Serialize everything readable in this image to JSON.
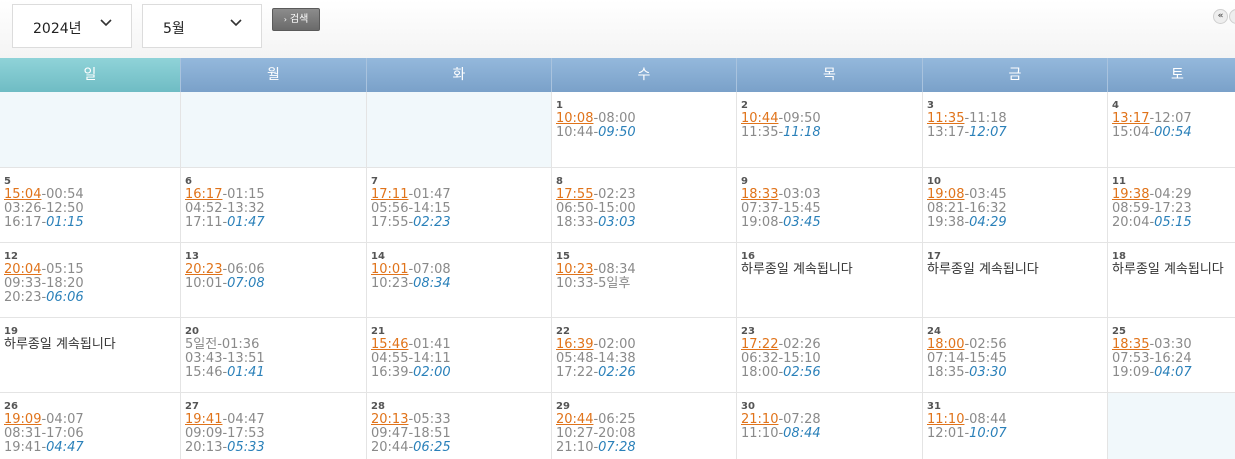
{
  "toolbar": {
    "year": "2024년",
    "month": "5월",
    "search_label": "검색",
    "prev_label": "«"
  },
  "weekdays": [
    "일",
    "월",
    "화",
    "수",
    "목",
    "금",
    "토"
  ],
  "colors": {
    "highlight": "#e0731a",
    "italic": "#2a80b9",
    "sunday_header": "#7fc7ce",
    "header": "#86abd2"
  },
  "weeks": [
    [
      {
        "empty": true
      },
      {
        "empty": true
      },
      {
        "empty": true
      },
      {
        "day": "1",
        "lines": [
          {
            "a": "10:08",
            "b": "-08:00",
            "t": "hl"
          },
          {
            "a": "10:44-",
            "b": "09:50",
            "t": "it"
          }
        ]
      },
      {
        "day": "2",
        "lines": [
          {
            "a": "10:44",
            "b": "-09:50",
            "t": "hl"
          },
          {
            "a": "11:35-",
            "b": "11:18",
            "t": "it"
          }
        ]
      },
      {
        "day": "3",
        "lines": [
          {
            "a": "11:35",
            "b": "-11:18",
            "t": "hl"
          },
          {
            "a": "13:17-",
            "b": "12:07",
            "t": "it"
          }
        ]
      },
      {
        "day": "4",
        "lines": [
          {
            "a": "13:17",
            "b": "-12:07",
            "t": "hl"
          },
          {
            "a": "15:04-",
            "b": "00:54",
            "t": "it"
          }
        ]
      }
    ],
    [
      {
        "day": "5",
        "lines": [
          {
            "a": "15:04",
            "b": "-00:54",
            "t": "hl"
          },
          {
            "a": "03:26-12:50",
            "b": "",
            "t": "nm"
          },
          {
            "a": "16:17-",
            "b": "01:15",
            "t": "it"
          }
        ]
      },
      {
        "day": "6",
        "lines": [
          {
            "a": "16:17",
            "b": "-01:15",
            "t": "hl"
          },
          {
            "a": "04:52-13:32",
            "b": "",
            "t": "nm"
          },
          {
            "a": "17:11-",
            "b": "01:47",
            "t": "it"
          }
        ]
      },
      {
        "day": "7",
        "lines": [
          {
            "a": "17:11",
            "b": "-01:47",
            "t": "hl"
          },
          {
            "a": "05:56-14:15",
            "b": "",
            "t": "nm"
          },
          {
            "a": "17:55-",
            "b": "02:23",
            "t": "it"
          }
        ]
      },
      {
        "day": "8",
        "lines": [
          {
            "a": "17:55",
            "b": "-02:23",
            "t": "hl"
          },
          {
            "a": "06:50-15:00",
            "b": "",
            "t": "nm"
          },
          {
            "a": "18:33-",
            "b": "03:03",
            "t": "it"
          }
        ]
      },
      {
        "day": "9",
        "lines": [
          {
            "a": "18:33",
            "b": "-03:03",
            "t": "hl"
          },
          {
            "a": "07:37-15:45",
            "b": "",
            "t": "nm"
          },
          {
            "a": "19:08-",
            "b": "03:45",
            "t": "it"
          }
        ]
      },
      {
        "day": "10",
        "lines": [
          {
            "a": "19:08",
            "b": "-03:45",
            "t": "hl"
          },
          {
            "a": "08:21-16:32",
            "b": "",
            "t": "nm"
          },
          {
            "a": "19:38-",
            "b": "04:29",
            "t": "it"
          }
        ]
      },
      {
        "day": "11",
        "lines": [
          {
            "a": "19:38",
            "b": "-04:29",
            "t": "hl"
          },
          {
            "a": "08:59-17:23",
            "b": "",
            "t": "nm"
          },
          {
            "a": "20:04-",
            "b": "05:15",
            "t": "it"
          }
        ]
      }
    ],
    [
      {
        "day": "12",
        "lines": [
          {
            "a": "20:04",
            "b": "-05:15",
            "t": "hl"
          },
          {
            "a": "09:33-18:20",
            "b": "",
            "t": "nm"
          },
          {
            "a": "20:23-",
            "b": "06:06",
            "t": "it"
          }
        ]
      },
      {
        "day": "13",
        "lines": [
          {
            "a": "20:23",
            "b": "-06:06",
            "t": "hl"
          },
          {
            "a": "10:01-",
            "b": "07:08",
            "t": "it"
          }
        ]
      },
      {
        "day": "14",
        "lines": [
          {
            "a": "10:01",
            "b": "-07:08",
            "t": "hl"
          },
          {
            "a": "10:23-",
            "b": "08:34",
            "t": "it"
          }
        ]
      },
      {
        "day": "15",
        "lines": [
          {
            "a": "10:23",
            "b": "-08:34",
            "t": "hl"
          },
          {
            "a": "10:33-5일후",
            "b": "",
            "t": "nm"
          }
        ]
      },
      {
        "day": "16",
        "allday": "하루종일 계속됩니다"
      },
      {
        "day": "17",
        "allday": "하루종일 계속됩니다"
      },
      {
        "day": "18",
        "allday": "하루종일 계속됩니다"
      }
    ],
    [
      {
        "day": "19",
        "allday": "하루종일 계속됩니다"
      },
      {
        "day": "20",
        "lines": [
          {
            "a": "5일전-01:36",
            "b": "",
            "t": "nm"
          },
          {
            "a": "03:43-13:51",
            "b": "",
            "t": "nm"
          },
          {
            "a": "15:46-",
            "b": "01:41",
            "t": "it"
          }
        ]
      },
      {
        "day": "21",
        "lines": [
          {
            "a": "15:46",
            "b": "-01:41",
            "t": "hl"
          },
          {
            "a": "04:55-14:11",
            "b": "",
            "t": "nm"
          },
          {
            "a": "16:39-",
            "b": "02:00",
            "t": "it"
          }
        ]
      },
      {
        "day": "22",
        "lines": [
          {
            "a": "16:39",
            "b": "-02:00",
            "t": "hl"
          },
          {
            "a": "05:48-14:38",
            "b": "",
            "t": "nm"
          },
          {
            "a": "17:22-",
            "b": "02:26",
            "t": "it"
          }
        ]
      },
      {
        "day": "23",
        "lines": [
          {
            "a": "17:22",
            "b": "-02:26",
            "t": "hl"
          },
          {
            "a": "06:32-15:10",
            "b": "",
            "t": "nm"
          },
          {
            "a": "18:00-",
            "b": "02:56",
            "t": "it"
          }
        ]
      },
      {
        "day": "24",
        "lines": [
          {
            "a": "18:00",
            "b": "-02:56",
            "t": "hl"
          },
          {
            "a": "07:14-15:45",
            "b": "",
            "t": "nm"
          },
          {
            "a": "18:35-",
            "b": "03:30",
            "t": "it"
          }
        ]
      },
      {
        "day": "25",
        "lines": [
          {
            "a": "18:35",
            "b": "-03:30",
            "t": "hl"
          },
          {
            "a": "07:53-16:24",
            "b": "",
            "t": "nm"
          },
          {
            "a": "19:09-",
            "b": "04:07",
            "t": "it"
          }
        ]
      }
    ],
    [
      {
        "day": "26",
        "lines": [
          {
            "a": "19:09",
            "b": "-04:07",
            "t": "hl"
          },
          {
            "a": "08:31-17:06",
            "b": "",
            "t": "nm"
          },
          {
            "a": "19:41-",
            "b": "04:47",
            "t": "it"
          }
        ]
      },
      {
        "day": "27",
        "lines": [
          {
            "a": "19:41",
            "b": "-04:47",
            "t": "hl"
          },
          {
            "a": "09:09-17:53",
            "b": "",
            "t": "nm"
          },
          {
            "a": "20:13-",
            "b": "05:33",
            "t": "it"
          }
        ]
      },
      {
        "day": "28",
        "lines": [
          {
            "a": "20:13",
            "b": "-05:33",
            "t": "hl"
          },
          {
            "a": "09:47-18:51",
            "b": "",
            "t": "nm"
          },
          {
            "a": "20:44-",
            "b": "06:25",
            "t": "it"
          }
        ]
      },
      {
        "day": "29",
        "lines": [
          {
            "a": "20:44",
            "b": "-06:25",
            "t": "hl"
          },
          {
            "a": "10:27-20:08",
            "b": "",
            "t": "nm"
          },
          {
            "a": "21:10-",
            "b": "07:28",
            "t": "it"
          }
        ]
      },
      {
        "day": "30",
        "lines": [
          {
            "a": "21:10",
            "b": "-07:28",
            "t": "hl"
          },
          {
            "a": "11:10-",
            "b": "08:44",
            "t": "it"
          }
        ]
      },
      {
        "day": "31",
        "lines": [
          {
            "a": "11:10",
            "b": "-08:44",
            "t": "hl"
          },
          {
            "a": "12:01-",
            "b": "10:07",
            "t": "it"
          }
        ]
      },
      {
        "empty": true
      }
    ]
  ]
}
